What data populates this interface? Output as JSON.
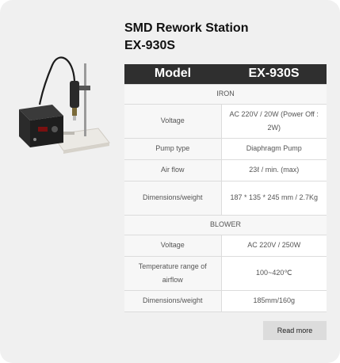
{
  "product": {
    "title_line1": "SMD Rework Station",
    "title_line2": "EX-930S",
    "image_icon": "rework-station-photo"
  },
  "table": {
    "header_left": "Model",
    "header_right": "EX-930S",
    "sections": [
      {
        "name": "IRON",
        "rows": [
          {
            "label": "Voltage",
            "value": "AC 220V / 20W (Power Off : 2W)"
          },
          {
            "label": "Pump type",
            "value": "Diaphragm Pump"
          },
          {
            "label": "Air flow",
            "value": "23ℓ / min. (max)"
          },
          {
            "label": "Dimensions/weight",
            "value": "187 * 135 * 245 mm / 2.7Kg"
          }
        ]
      },
      {
        "name": "BLOWER",
        "rows": [
          {
            "label": "Voltage",
            "value": "AC 220V / 250W"
          },
          {
            "label": "Temperature range of airflow",
            "value": "100~420℃"
          },
          {
            "label": "Dimensions/weight",
            "value": "185mm/160g"
          }
        ]
      }
    ]
  },
  "actions": {
    "read_more_label": "Read more"
  }
}
